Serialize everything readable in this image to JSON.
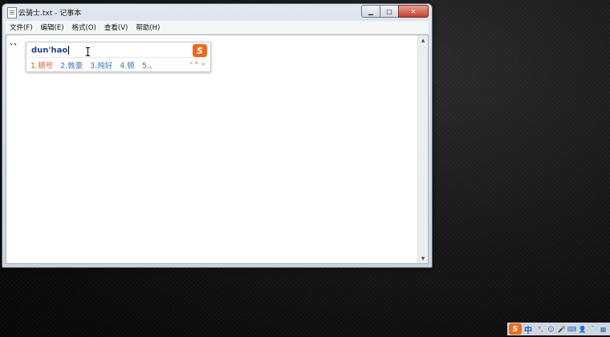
{
  "window": {
    "title": "云骑士.txt - 记事本",
    "buttons": {
      "minimize": "▁",
      "maximize": "□",
      "close": "✕"
    }
  },
  "menu": [
    {
      "label": "文件(F)"
    },
    {
      "label": "编辑(E)"
    },
    {
      "label": "格式(O)"
    },
    {
      "label": "查看(V)"
    },
    {
      "label": "帮助(H)"
    }
  ],
  "editor": {
    "content": "、、"
  },
  "scrollbar": {
    "up": "▲",
    "down": "▼"
  },
  "ime": {
    "input": "dun'hao",
    "logo": "S",
    "candidates": [
      {
        "label": "1.顿号"
      },
      {
        "label": "2.敦豪"
      },
      {
        "label": "3.炖好"
      },
      {
        "label": "4.顿"
      },
      {
        "label": "5.、"
      }
    ],
    "nav": {
      "prev": "‹",
      "next": "›",
      "more": "⌄"
    }
  },
  "tray": {
    "logo": "S",
    "mode": "中",
    "icons": [
      "°,",
      "☺",
      "🎤",
      "⌨",
      "👤",
      "👕",
      "▦"
    ]
  },
  "colors": {
    "ime_active": "#e05a2a",
    "ime_candidate": "#3d74b8",
    "sogou_orange": "#f06a1e"
  }
}
